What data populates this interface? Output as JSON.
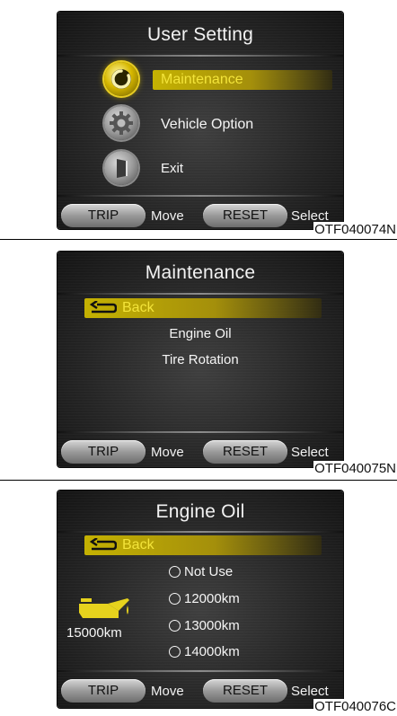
{
  "panels": [
    {
      "title": "User Setting",
      "items": [
        {
          "label": "Maintenance",
          "icon": "power-icon"
        },
        {
          "label": "Vehicle Option",
          "icon": "gear-icon"
        },
        {
          "label": "Exit",
          "icon": "door-icon"
        }
      ],
      "buttons": {
        "trip": "TRIP",
        "move": "Move",
        "reset": "RESET",
        "select": "Select"
      },
      "code": "OTF040074N"
    },
    {
      "title": "Maintenance",
      "back": "Back",
      "items": [
        "Engine Oil",
        "Tire Rotation"
      ],
      "buttons": {
        "trip": "TRIP",
        "move": "Move",
        "reset": "RESET",
        "select": "Select"
      },
      "code": "OTF040075N"
    },
    {
      "title": "Engine Oil",
      "back": "Back",
      "current": "15000km",
      "options": [
        "Not Use",
        "12000km",
        "13000km",
        "14000km"
      ],
      "buttons": {
        "trip": "TRIP",
        "move": "Move",
        "reset": "RESET",
        "select": "Select"
      },
      "code": "OTF040076C"
    }
  ],
  "colors": {
    "highlight": "#f3e43a",
    "screen": "#262626"
  }
}
